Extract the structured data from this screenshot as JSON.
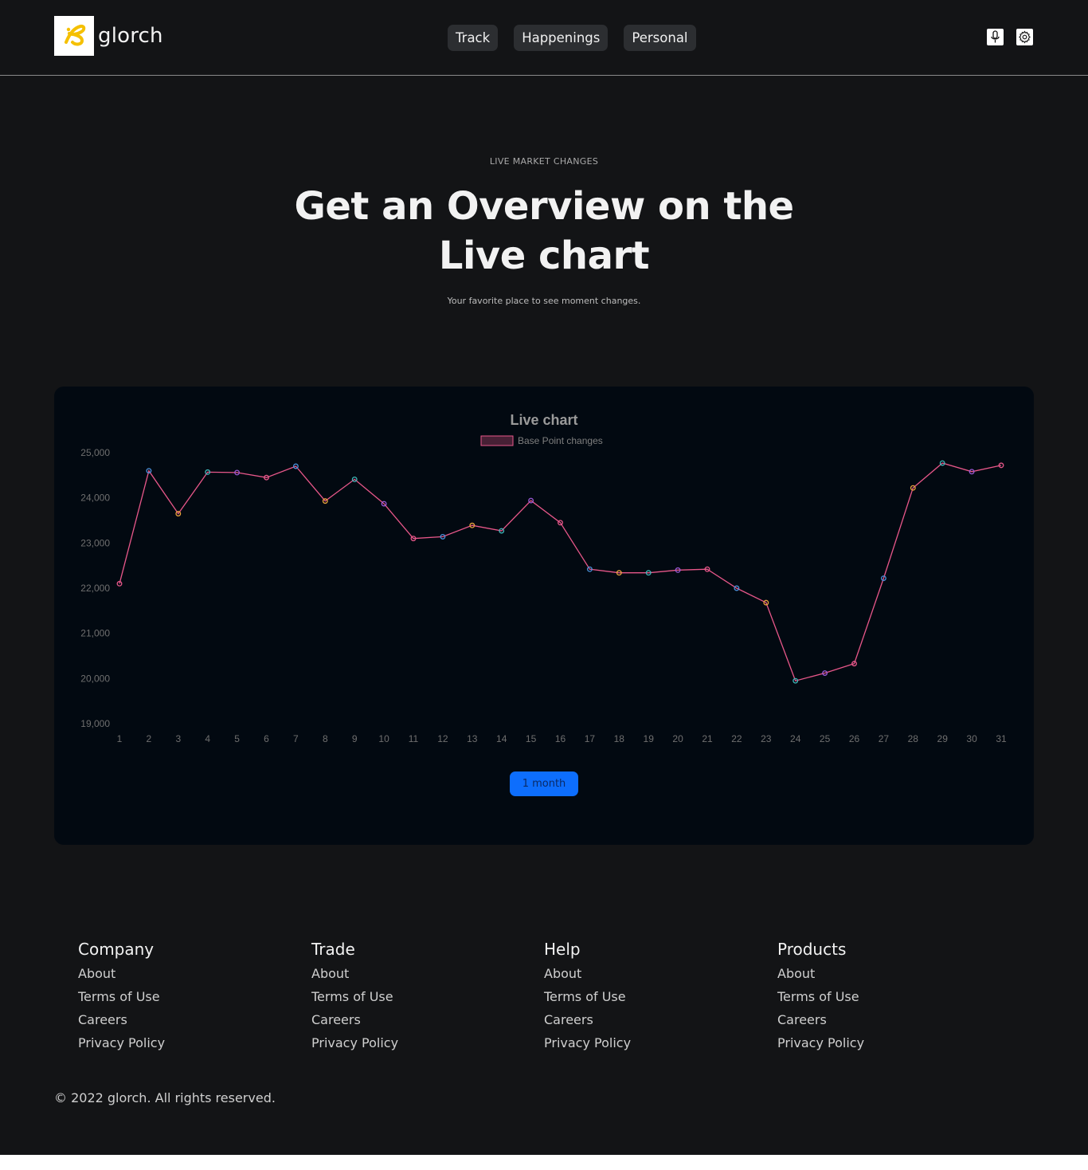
{
  "header": {
    "brand": "glorch",
    "nav": [
      {
        "label": "Track"
      },
      {
        "label": "Happenings"
      },
      {
        "label": "Personal"
      }
    ],
    "icons": [
      "microphone-icon",
      "settings-icon"
    ]
  },
  "hero": {
    "eyebrow": "LIVE MARKET CHANGES",
    "title_line1": "Get an Overview on the",
    "title_line2": "Live chart",
    "subtitle": "Your favorite place to see moment changes."
  },
  "chart": {
    "range_button": "1 month"
  },
  "chart_data": {
    "type": "line",
    "title": "Live chart",
    "legend_placement": "top-center",
    "grid": false,
    "x": [
      1,
      2,
      3,
      4,
      5,
      6,
      7,
      8,
      9,
      10,
      11,
      12,
      13,
      14,
      15,
      16,
      17,
      18,
      19,
      20,
      21,
      22,
      23,
      24,
      25,
      26,
      27,
      28,
      29,
      30,
      31
    ],
    "ylim": [
      19000,
      25000
    ],
    "yticks": [
      "25,000",
      "24,000",
      "23,000",
      "22,000",
      "21,000",
      "20,000",
      "19,000"
    ],
    "series": [
      {
        "name": "Base Point changes",
        "line_color": "#e8578a",
        "values": [
          22100,
          24600,
          23650,
          24570,
          24560,
          24450,
          24700,
          23930,
          24410,
          23870,
          23100,
          23140,
          23390,
          23270,
          23940,
          23450,
          22420,
          22340,
          22340,
          22400,
          22420,
          22000,
          21680,
          19950,
          20120,
          20330,
          22220,
          24220,
          24770,
          24580,
          24720
        ]
      }
    ],
    "point_colors": [
      "#e8578a",
      "#4a90d9",
      "#e8a23c",
      "#3fb5b8",
      "#9b59d6"
    ]
  },
  "footer": {
    "columns": [
      {
        "title": "Company",
        "links": [
          "About",
          "Terms of Use",
          "Careers",
          "Privacy Policy"
        ]
      },
      {
        "title": "Trade",
        "links": [
          "About",
          "Terms of Use",
          "Careers",
          "Privacy Policy"
        ]
      },
      {
        "title": "Help",
        "links": [
          "About",
          "Terms of Use",
          "Careers",
          "Privacy Policy"
        ]
      },
      {
        "title": "Products",
        "links": [
          "About",
          "Terms of Use",
          "Careers",
          "Privacy Policy"
        ]
      }
    ],
    "copyright": "© 2022 glorch. All rights reserved."
  },
  "colors": {
    "page_bg": "#131416",
    "card_bg": "#020911",
    "accent_blue": "#0d6efd",
    "logo_yellow": "#f5c000"
  }
}
